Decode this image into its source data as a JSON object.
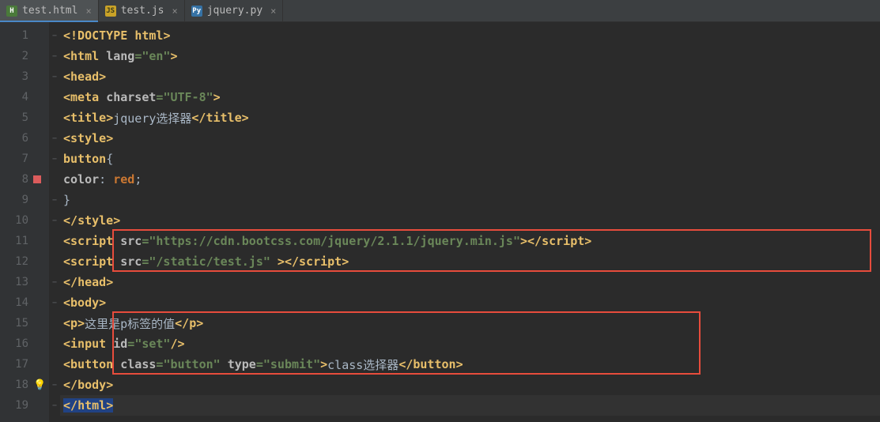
{
  "tabs": [
    {
      "name": "test.html",
      "icon": "H",
      "active": true
    },
    {
      "name": "test.js",
      "icon": "JS",
      "active": false
    },
    {
      "name": "jquery.py",
      "icon": "Py",
      "active": false
    }
  ],
  "gutter": {
    "lines": [
      "1",
      "2",
      "3",
      "4",
      "5",
      "6",
      "7",
      "8",
      "9",
      "10",
      "11",
      "12",
      "13",
      "14",
      "15",
      "16",
      "17",
      "18",
      "19"
    ],
    "breakpoint_line": 8,
    "bulb_line": 18
  },
  "code": {
    "l1": {
      "p1": "<!DOCTYPE ",
      "p2": "html",
      "p3": ">"
    },
    "l2": {
      "p1": "<",
      "p2": "html ",
      "p3": "lang",
      "p4": "=",
      "p5": "\"en\"",
      "p6": ">"
    },
    "l3": {
      "p1": "<",
      "p2": "head",
      "p3": ">"
    },
    "l4": {
      "p1": "<",
      "p2": "meta ",
      "p3": "charset",
      "p4": "=",
      "p5": "\"UTF-8\"",
      "p6": ">"
    },
    "l5": {
      "p1": "<",
      "p2": "title",
      "p3": ">",
      "p4": "jquery选择器",
      "p5": "</",
      "p6": "title",
      "p7": ">"
    },
    "l6": {
      "p1": "<",
      "p2": "style",
      "p3": ">"
    },
    "l7": {
      "p1": "button",
      "p2": "{"
    },
    "l8": {
      "p1": "color",
      "p2": ": ",
      "p3": "red",
      "p4": ";"
    },
    "l9": {
      "p1": "}"
    },
    "l10": {
      "p1": "</",
      "p2": "style",
      "p3": ">"
    },
    "l11": {
      "p1": "<",
      "p2": "script ",
      "p3": "src",
      "p4": "=",
      "p5": "\"https://cdn.bootcss.com/jquery/2.1.1/jquery.min.js\"",
      "p6": ">",
      "p7": "</",
      "p8": "script",
      "p9": ">"
    },
    "l12": {
      "p1": "<",
      "p2": "script ",
      "p3": "src",
      "p4": "=",
      "p5": "\"/static/test.js\"",
      "p6": " >",
      "p7": "</",
      "p8": "script",
      "p9": ">"
    },
    "l13": {
      "p1": "</",
      "p2": "head",
      "p3": ">"
    },
    "l14": {
      "p1": "<",
      "p2": "body",
      "p3": ">"
    },
    "l15": {
      "p1": "<",
      "p2": "p",
      "p3": ">",
      "p4": "这里是p标签的值",
      "p5": "</",
      "p6": "p",
      "p7": ">"
    },
    "l16": {
      "p1": "<",
      "p2": "input ",
      "p3": "id",
      "p4": "=",
      "p5": "\"set\"",
      "p6": "/>"
    },
    "l17": {
      "p1": "<",
      "p2": "button ",
      "p3": "class",
      "p4": "=",
      "p5": "\"button\"",
      "p6": " ",
      "p7": "type",
      "p8": "=",
      "p9": "\"submit\"",
      "p10": ">",
      "p11": "class选择器",
      "p12": "</",
      "p13": "button",
      "p14": ">"
    },
    "l18": {
      "p1": "</",
      "p2": "body",
      "p3": ">"
    },
    "l19": {
      "p1": "</",
      "p2": "html",
      "p3": ">"
    }
  }
}
